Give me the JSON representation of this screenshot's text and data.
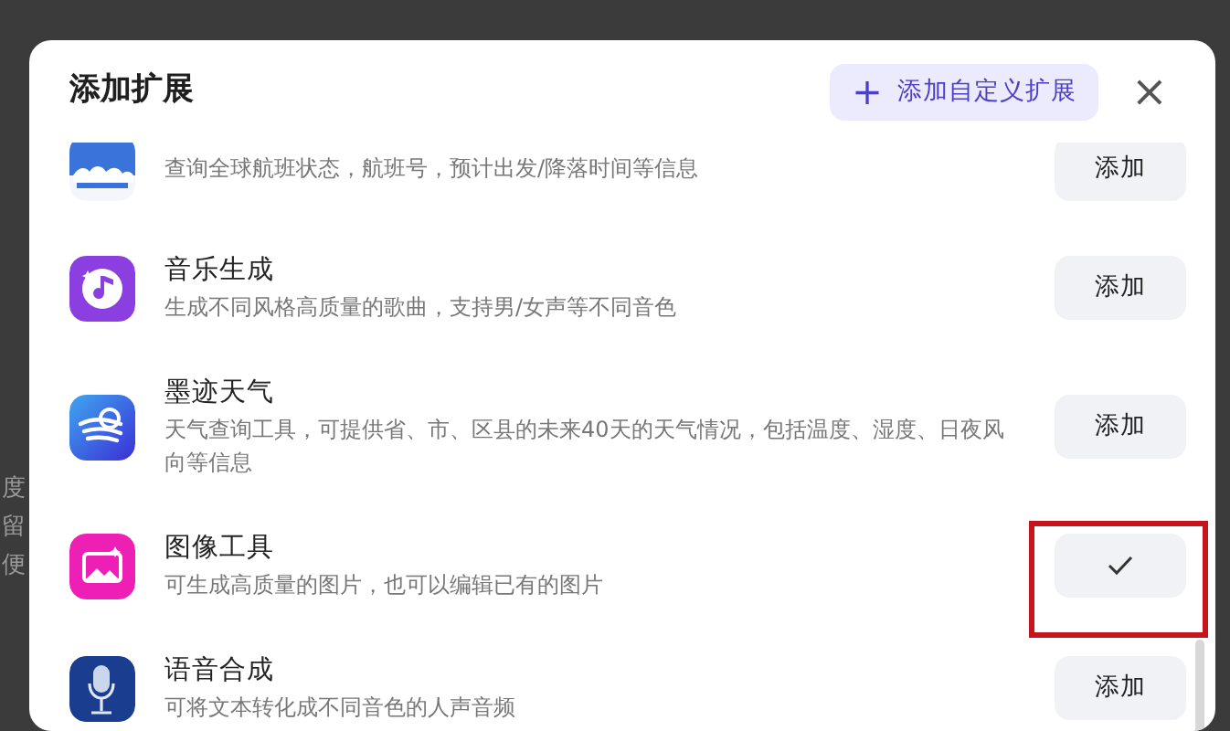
{
  "background": {
    "texts": [
      "度",
      "留",
      "便"
    ]
  },
  "dialog": {
    "title": "添加扩展",
    "custom_button": {
      "icon": "+",
      "label": "添加自定义扩展"
    },
    "close": "×"
  },
  "extensions": [
    {
      "kind": "flight",
      "description": "查询全球航班状态，航班号，预计出发/降落时间等信息",
      "added": false,
      "button": "添加",
      "highlighted": false
    },
    {
      "kind": "music",
      "name": "音乐生成",
      "description": "生成不同风格高质量的歌曲，支持男/女声等不同音色",
      "added": false,
      "button": "添加",
      "highlighted": false
    },
    {
      "kind": "weather",
      "name": "墨迹天气",
      "description": "天气查询工具，可提供省、市、区县的未来40天的天气情况，包括温度、湿度、日夜风向等信息",
      "added": false,
      "button": "添加",
      "highlighted": false
    },
    {
      "kind": "image",
      "name": "图像工具",
      "description": "可生成高质量的图片，也可以编辑已有的图片",
      "added": true,
      "highlighted": true
    },
    {
      "kind": "voice",
      "name": "语音合成",
      "description": "可将文本转化成不同音色的人声音频",
      "added": false,
      "button": "添加",
      "highlighted": false
    }
  ]
}
